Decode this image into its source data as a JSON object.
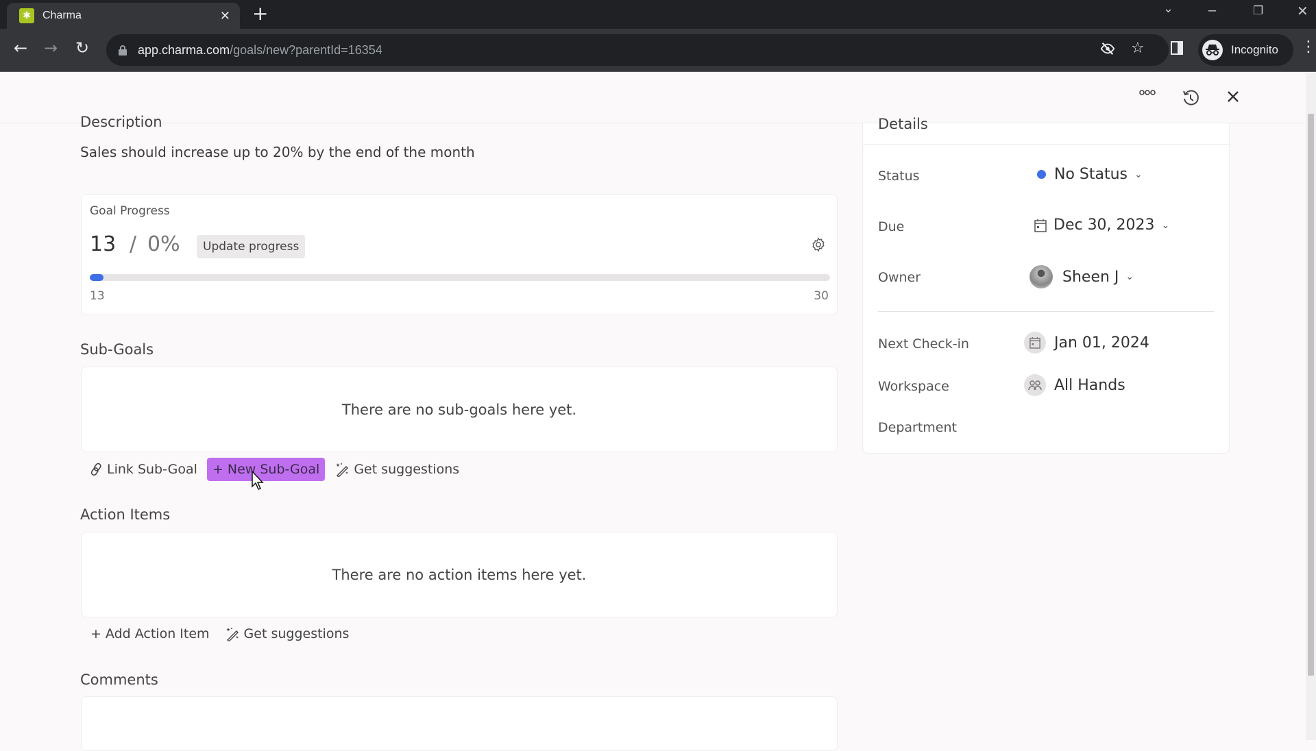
{
  "browser": {
    "tab_title": "Charma",
    "tab_favicon": "charma-logo-icon",
    "url_host": "app.charma.com",
    "url_path": "/goals/new?parentId=16354",
    "profile_label": "Incognito"
  },
  "header": {
    "icons": [
      "more-options-icon",
      "history-icon",
      "close-icon"
    ]
  },
  "description": {
    "title": "Description",
    "text": "Sales should increase up to 20% by the end of the month"
  },
  "goal_progress": {
    "label": "Goal Progress",
    "current_value": "13",
    "separator": "/",
    "percent": "0%",
    "update_button": "Update progress",
    "range_min": "13",
    "range_max": "30",
    "progress_fraction": 0
  },
  "sub_goals": {
    "title": "Sub-Goals",
    "empty_text": "There are no sub-goals here yet.",
    "actions": {
      "link": "Link Sub-Goal",
      "new": "New Sub-Goal",
      "suggest": "Get suggestions"
    }
  },
  "action_items": {
    "title": "Action Items",
    "empty_text": "There are no action items here yet.",
    "actions": {
      "add": "Add Action Item",
      "suggest": "Get suggestions"
    }
  },
  "comments": {
    "title": "Comments"
  },
  "details": {
    "title": "Details",
    "status_label": "Status",
    "status_value": "No Status",
    "status_color": "#3f6fe6",
    "due_label": "Due",
    "due_value": "Dec 30, 2023",
    "owner_label": "Owner",
    "owner_value": "Sheen J",
    "checkin_label": "Next Check-in",
    "checkin_value": "Jan 01, 2024",
    "workspace_label": "Workspace",
    "workspace_value": "All Hands",
    "department_label": "Department"
  },
  "colors": {
    "accent_purple": "#c06ef0",
    "progress_blue": "#3f6fe6"
  }
}
